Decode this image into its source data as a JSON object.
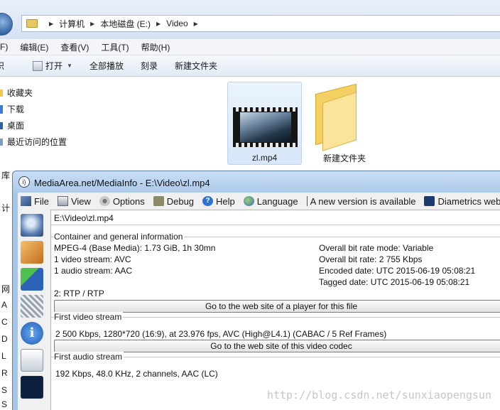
{
  "explorer": {
    "address": [
      "计算机",
      "本地磁盘 (E:)",
      "Video"
    ],
    "menu": [
      "F)",
      "编辑(E)",
      "查看(V)",
      "工具(T)",
      "帮助(H)"
    ],
    "command_bar": {
      "org_fragment": "织",
      "open": "打开",
      "play_all": "全部播放",
      "burn": "刻录",
      "new_folder": "新建文件夹"
    },
    "sidebar": {
      "favorites": "收藏夹",
      "downloads": "下载",
      "desktop": "桌面",
      "recent": "最近访问的位置"
    },
    "files": [
      {
        "name": "zl.mp4",
        "type": "video"
      },
      {
        "name": "新建文件夹",
        "type": "folder"
      }
    ],
    "tree_fragments": [
      "库",
      "计",
      "网",
      "A",
      "C",
      "D",
      "L",
      "R",
      "S",
      "S"
    ]
  },
  "mediainfo": {
    "title": "MediaArea.net/MediaInfo - E:\\Video\\zl.mp4",
    "menu": [
      "File",
      "View",
      "Options",
      "Debug",
      "Help",
      "Language",
      "A new version is available",
      "Diametrics web"
    ],
    "file_path": "E:\\Video\\zl.mp4",
    "general": {
      "title": "Container and general information",
      "left": [
        "MPEG-4 (Base Media): 1.73 GiB, 1h 30mn",
        "1 video stream: AVC",
        "1 audio stream: AAC"
      ],
      "right": [
        "Overall bit rate mode: Variable",
        "Overall bit rate: 2 755 Kbps",
        "Encoded date: UTC 2015-06-19 05:08:21",
        "Tagged date: UTC 2015-06-19 05:08:21"
      ],
      "extra": "2: RTP / RTP",
      "button": "Go to the web site of a player for this file"
    },
    "video": {
      "title": "First video stream",
      "info": "2 500 Kbps, 1280*720 (16:9), at 23.976 fps, AVC (High@L4.1) (CABAC / 5 Ref Frames)",
      "button": "Go to the web site of this video codec"
    },
    "audio": {
      "title": "First audio stream",
      "info": "192 Kbps, 48.0 KHz, 2 channels, AAC (LC)"
    }
  },
  "watermark": "http://blog.csdn.net/sunxiaopengsun"
}
